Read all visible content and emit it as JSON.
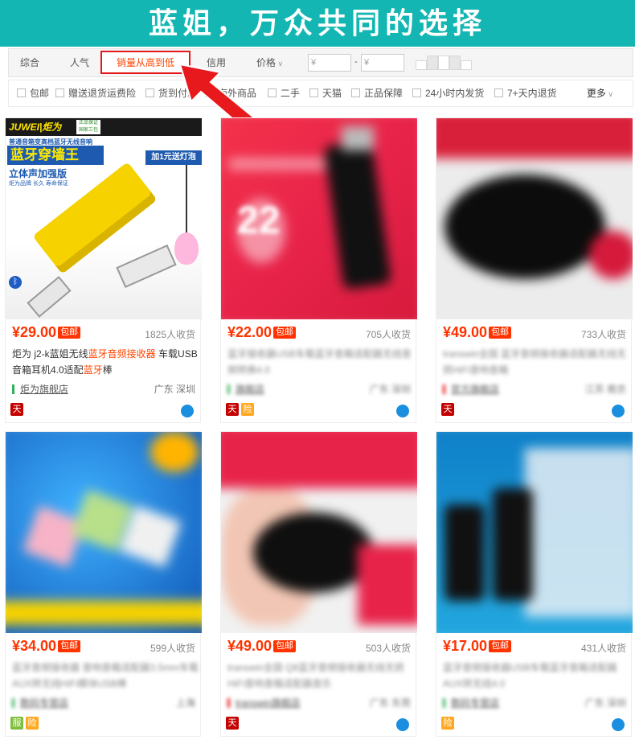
{
  "banner": {
    "text": "蓝姐，万众共同的选择"
  },
  "sortbar": {
    "items": [
      "综合",
      "人气",
      "销量从高到低",
      "信用",
      "价格"
    ],
    "price_min_placeholder": "¥",
    "price_max_placeholder": "¥",
    "price_dash": "-"
  },
  "filters": {
    "items": [
      "包邮",
      "赠送退货运费险",
      "货到付款",
      "海外商品",
      "二手",
      "天猫",
      "正品保障",
      "24小时内发货",
      "7+天内退货"
    ],
    "more": "更多"
  },
  "products": [
    {
      "price": "¥29.00",
      "tag": "包邮",
      "sold": "1825人收货",
      "title_parts": [
        "炬为 j2-k蓝姐无线",
        "蓝牙音频接收器",
        " 车载USB音箱耳机4.0适配",
        "蓝牙",
        "棒"
      ],
      "shop": "炬为旗舰店",
      "location": "广东 深圳",
      "image_text": {
        "brand": "JUWEI|炬为",
        "seal": "正品保证 国家三包",
        "line1": "普通音箱变高档蓝牙无线音响",
        "line2": "蓝牙穿墙王",
        "line3": "立体声加强版",
        "line4": "炬为品牌 长久 寿命保证",
        "promo": "加1元送灯泡"
      },
      "badges": [
        "天"
      ]
    },
    {
      "price": "¥22.00",
      "tag": "包邮",
      "sold": "705人收货",
      "title_parts": [
        "蓝牙接收器USB车载蓝牙音箱适配器无线音频转换4.0"
      ],
      "shop": "旗舰店",
      "location": "广东 深圳",
      "image_text": {
        "big_number": "22"
      },
      "badges": [
        "天",
        "险"
      ]
    },
    {
      "price": "¥49.00",
      "tag": "包邮",
      "sold": "733人收货",
      "title_parts": [
        "transwin全国 蓝牙音频接收器适配器无线无损HiFi音响音箱"
      ],
      "shop": "官方旗舰店",
      "location": "江苏 南京",
      "image_text": {},
      "badges": [
        "天"
      ]
    },
    {
      "price": "¥34.00",
      "tag": "包邮",
      "sold": "599人收货",
      "title_parts": [
        "蓝牙音频接收器 音响音箱适配器3.5mm车载AUX转无线HiFi模块USB棒"
      ],
      "shop": "数码专营店",
      "location": "上海",
      "image_text": {},
      "badges": [
        "服",
        "险"
      ]
    },
    {
      "price": "¥49.00",
      "tag": "包邮",
      "sold": "503人收货",
      "title_parts": [
        "transwin全国 Q8蓝牙音频接收器无线无损HiFi音响音箱适配器音乐"
      ],
      "shop": "transwin旗舰店",
      "location": "广东 东莞",
      "image_text": {},
      "badges": [
        "天"
      ]
    },
    {
      "price": "¥17.00",
      "tag": "包邮",
      "sold": "431人收货",
      "title_parts": [
        "蓝牙音频接收器USB车载蓝牙音箱适配器AUX转无线4.0"
      ],
      "shop": "数码专营店",
      "location": "广东 深圳",
      "image_text": {},
      "badges": [
        "险"
      ]
    }
  ],
  "colors": {
    "banner": "#13b6b2",
    "price": "#ff3300",
    "active_sort_border": "#e4181b",
    "arrow": "#e8191d"
  }
}
